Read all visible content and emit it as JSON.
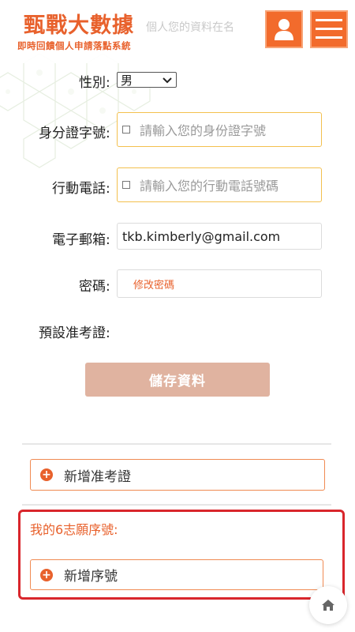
{
  "header": {
    "logo_title": "甄戰大數據",
    "logo_subtitle": "即時回饋個人申請落點系統",
    "ghost_text": "個人您的資料在名",
    "user_icon": "user-icon",
    "menu_icon": "hamburger-menu-icon"
  },
  "form": {
    "gender": {
      "label": "性別:",
      "value": "男"
    },
    "id_number": {
      "label": "身分證字號:",
      "placeholder": "請輸入您的身份證字號"
    },
    "mobile": {
      "label": "行動電話:",
      "placeholder": "請輸入您的行動電話號碼"
    },
    "email": {
      "label": "電子郵箱:",
      "value": "tkb.kimberly@gmail.com"
    },
    "password": {
      "label": "密碼:",
      "link": "修改密碼"
    },
    "default_admission": {
      "label": "預設准考證:"
    },
    "save_label": "儲存資料"
  },
  "actions": {
    "add_admission_ticket": "新增准考證",
    "preferences_title": "我的6志願序號:",
    "add_serial": "新增序號"
  },
  "colors": {
    "accent": "#e8612c",
    "save_button": "#e0b3a0",
    "highlight": "#d9262c",
    "focus_border": "#f3c04e"
  }
}
